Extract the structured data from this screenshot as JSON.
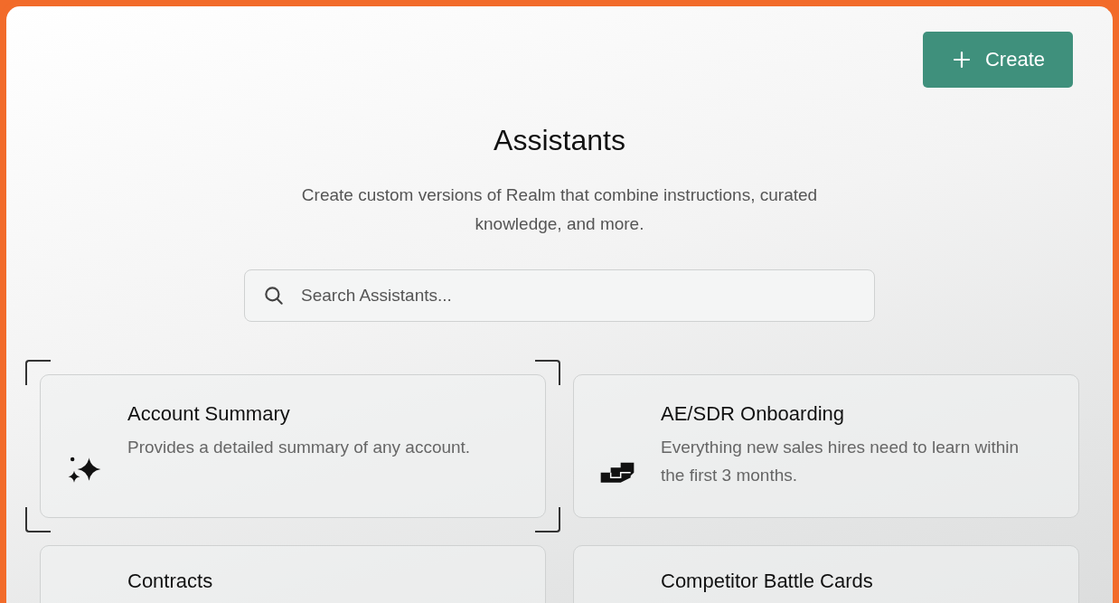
{
  "create_button": {
    "label": "Create"
  },
  "title": "Assistants",
  "subtitle": "Create custom versions of Realm that combine instructions, curated knowledge, and more.",
  "search": {
    "placeholder": "Search Assistants..."
  },
  "cards": [
    {
      "kind": "sparkles",
      "title": "Account Summary",
      "description": "Provides a detailed summary of any account.",
      "selected": true
    },
    {
      "kind": "stairs",
      "title": "AE/SDR Onboarding",
      "description": "Everything new sales hires need to learn within the first 3 months.",
      "selected": false
    },
    {
      "kind": "none",
      "title": "Contracts",
      "selected": false
    },
    {
      "kind": "none",
      "title": "Competitor Battle Cards",
      "selected": false
    }
  ]
}
